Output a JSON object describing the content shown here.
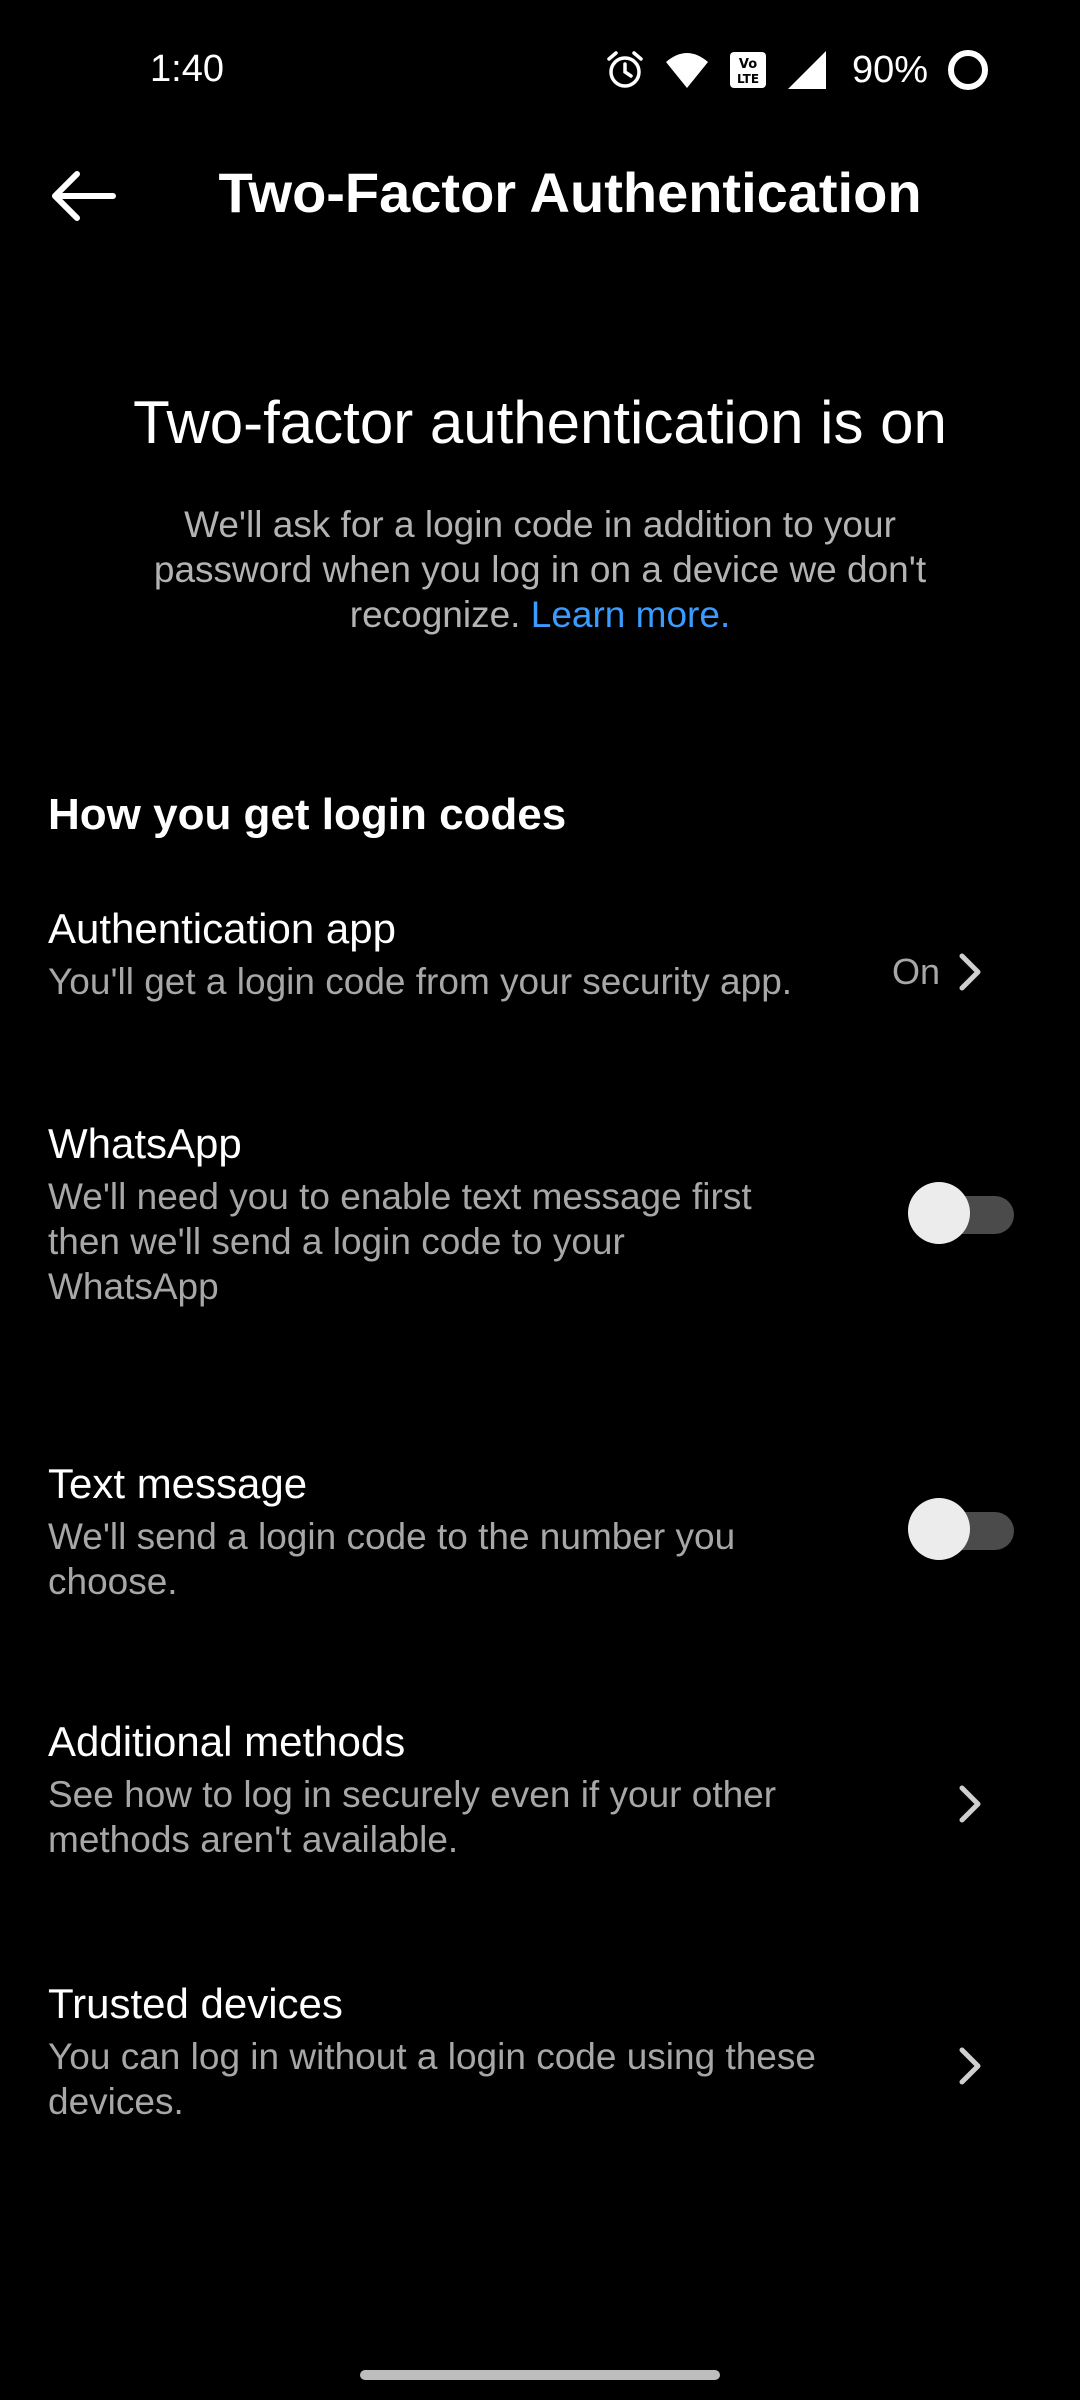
{
  "status_bar": {
    "time": "1:40",
    "battery_percent": "90%",
    "icons": [
      "alarm-icon",
      "wifi-icon",
      "volte-icon",
      "signal-icon",
      "battery-icon"
    ]
  },
  "app_bar": {
    "title": "Two-Factor Authentication",
    "back_icon": "arrow-left-icon"
  },
  "hero": {
    "title": "Two-factor authentication is on",
    "description": "We'll ask for a login code in addition to your password when you log in on a device we don't recognize.",
    "learn_more": "Learn more."
  },
  "section": {
    "header": "How you get login codes"
  },
  "methods": {
    "auth_app": {
      "title": "Authentication app",
      "subtitle": "You'll get a login code from your security app.",
      "status": "On"
    },
    "whatsapp": {
      "title": "WhatsApp",
      "subtitle": "We'll need you to enable text message first then we'll send a login code to your WhatsApp",
      "enabled": false
    },
    "text_message": {
      "title": "Text message",
      "subtitle": "We'll send a login code to the number you choose.",
      "enabled": false
    },
    "additional": {
      "title": "Additional methods",
      "subtitle": "See how to log in securely even if your other methods aren't available."
    },
    "trusted": {
      "title": "Trusted devices",
      "subtitle": "You can log in without a login code using these devices."
    }
  },
  "colors": {
    "background": "#000000",
    "text_primary": "#ffffff",
    "text_secondary": "#a7a7a7",
    "link": "#3b9cff",
    "toggle_track": "#4b4b4b",
    "toggle_thumb": "#ececec"
  }
}
